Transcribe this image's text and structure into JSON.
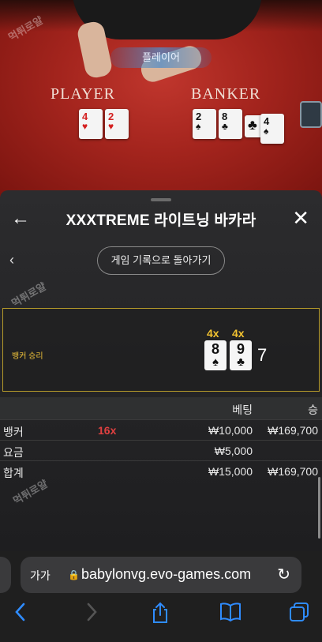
{
  "video": {
    "player_pill": "플레이어",
    "player_label": "PLAYER",
    "banker_label": "BANKER",
    "watermark": "먹튀로얄",
    "player_cards": [
      {
        "rank": "4",
        "suit": "♥",
        "color": "red"
      },
      {
        "rank": "2",
        "suit": "♥",
        "color": "red"
      }
    ],
    "banker_cards": [
      {
        "rank": "2",
        "suit": "♠",
        "color": "black"
      },
      {
        "rank": "8",
        "suit": "♣",
        "color": "black"
      },
      {
        "rank": "",
        "suit": "♣",
        "color": "black"
      },
      {
        "rank": "4",
        "suit": "♠",
        "color": "black"
      }
    ]
  },
  "sheet": {
    "back_icon": "←",
    "close_icon": "✕",
    "title": "XXXTREME 라이트닝 바카라",
    "chevron": "‹",
    "history_button": "게임 기록으로 돌아가기",
    "result": {
      "label": "뱅커 승리",
      "multipliers": [
        "4x",
        "4x"
      ],
      "cards": [
        {
          "rank": "8",
          "suit": "♠"
        },
        {
          "rank": "9",
          "suit": "♣"
        }
      ],
      "total": "7"
    },
    "table": {
      "headers": {
        "bet": "베팅",
        "win": "승"
      },
      "rows": [
        {
          "label": "뱅커",
          "multiplier": "16x",
          "bet": "₩10,000",
          "win": "₩169,700"
        },
        {
          "label": "요금",
          "multiplier": "",
          "bet": "₩5,000",
          "win": ""
        },
        {
          "label": "합계",
          "multiplier": "",
          "bet": "₩15,000",
          "win": "₩169,700"
        }
      ]
    }
  },
  "browser": {
    "text_size": "가가",
    "lock_icon": "🔒",
    "url": "babylonvg.evo-games.com",
    "reload_icon": "↻",
    "accent": "#2f8cff"
  }
}
